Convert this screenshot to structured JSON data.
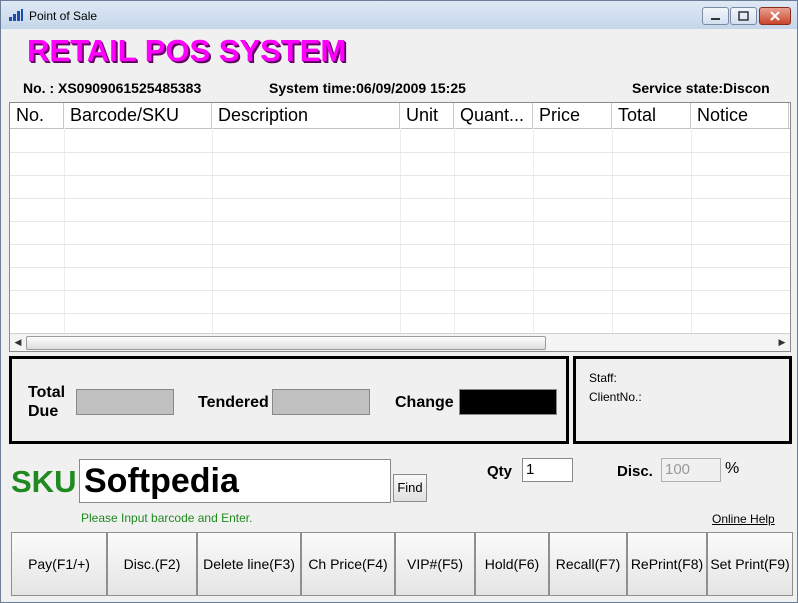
{
  "window": {
    "title": "Point of Sale"
  },
  "app": {
    "title": "RETAIL POS SYSTEM"
  },
  "info": {
    "receipt_no": "No. : XS0909061525485383",
    "system_time": "System time:06/09/2009 15:25",
    "service_state": "Service state:Discon"
  },
  "grid": {
    "columns": [
      "No.",
      "Barcode/SKU",
      "Description",
      "Unit",
      "Quant...",
      "Price",
      "Total",
      "Notice"
    ],
    "rows": []
  },
  "totals": {
    "total_due_label_1": "Total",
    "total_due_label_2": "Due",
    "tendered_label": "Tendered",
    "change_label": "Change",
    "total_due_value": "",
    "tendered_value": "",
    "change_value": ""
  },
  "staff_panel": {
    "staff_label": "Staff:",
    "client_label": "ClientNo.:"
  },
  "entry": {
    "sku_label": "SKU",
    "sku_value": "Softpedia",
    "find_label": "Find",
    "hint": "Please Input barcode and Enter.",
    "qty_label": "Qty",
    "qty_value": "1",
    "disc_label": "Disc.",
    "disc_value": "100",
    "disc_unit": "%",
    "help_link": "Online Help"
  },
  "function_buttons": [
    "Pay(F1/+)",
    "Disc.(F2)",
    "Delete line(F3)",
    "Ch Price(F4)",
    "VIP#(F5)",
    "Hold(F6)",
    "Recall(F7)",
    "RePrint(F8)",
    "Set Print(F9)"
  ],
  "colors": {
    "title_magenta": "#ff00ff",
    "sku_green": "#1f8a1f",
    "change_box": "#000000",
    "total_box": "#c0c0c0"
  }
}
